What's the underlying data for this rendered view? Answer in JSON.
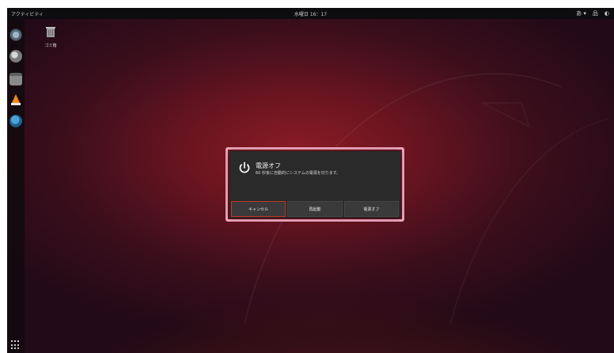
{
  "topbar": {
    "activities": "アクティビティ",
    "clock": "水曜日 16：17",
    "tray": [
      "あ ▾",
      "品",
      "◐"
    ]
  },
  "desktop": {
    "trash_label": "ゴミ箱"
  },
  "dialog": {
    "title": "電源オフ",
    "message": "60 秒後に自動的にシステムの電源を切ります。",
    "buttons": {
      "cancel": "キャンセル",
      "restart": "再起動",
      "power_off": "電源オフ"
    }
  },
  "colors": {
    "accent_focus": "#c0392b",
    "highlight": "#f0a8bf",
    "dialog_bg": "#2a2a2a"
  }
}
